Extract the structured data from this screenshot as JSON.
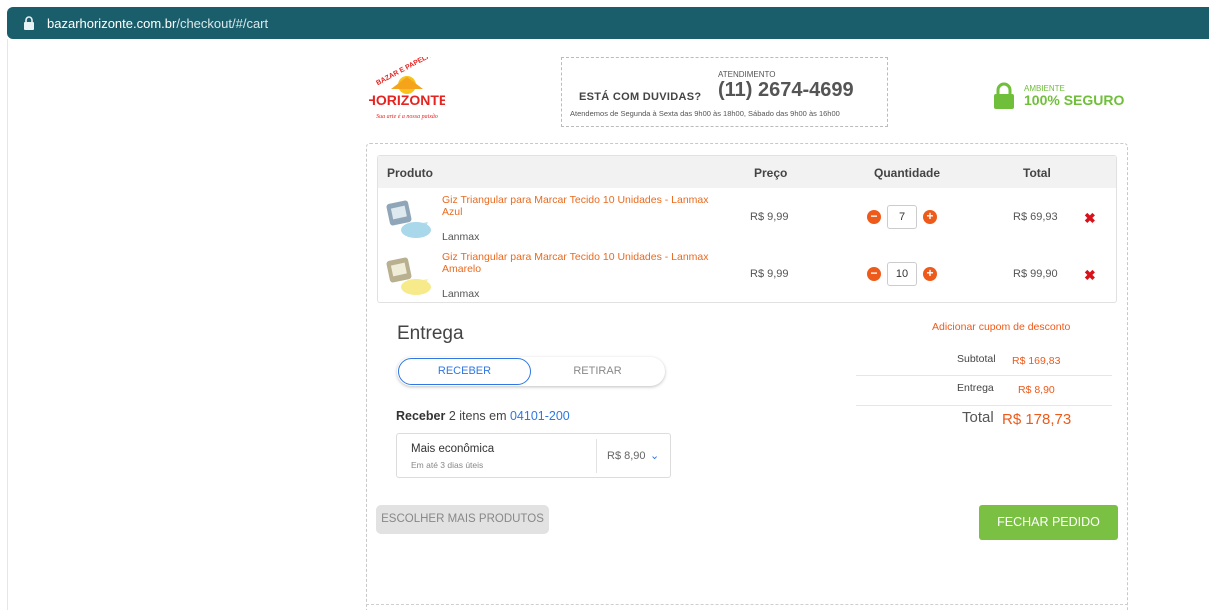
{
  "browser": {
    "url_domain": "bazarhorizonte.com.br",
    "url_path": "/checkout/#/cart"
  },
  "header": {
    "logo": {
      "top_text": "BAZAR E PAPELARIA",
      "name": "HORIZONTE",
      "tagline": "Sua arte é a nossa paixão"
    },
    "help": {
      "question": "ESTÁ COM DUVIDAS?",
      "label": "ATENDIMENTO",
      "phone": "(11) 2674-4699",
      "hours": "Atendemos de Segunda à Sexta das 9h00 às 18h00, Sábado das 9h00 às 16h00"
    },
    "secure": {
      "line1": "AMBIENTE",
      "line2": "100% SEGURO",
      "color": "#6fbf3a"
    }
  },
  "cart": {
    "columns": {
      "product": "Produto",
      "price": "Preço",
      "quantity": "Quantidade",
      "total": "Total"
    },
    "items": [
      {
        "name": "Giz Triangular para Marcar Tecido 10 Unidades - Lanmax Azul",
        "brand": "Lanmax",
        "price": "R$ 9,99",
        "quantity": "7",
        "total": "R$ 69,93",
        "thumb_color": "#a8d8ea"
      },
      {
        "name": "Giz Triangular para Marcar Tecido 10 Unidades - Lanmax Amarelo",
        "brand": "Lanmax",
        "price": "R$ 9,99",
        "quantity": "10",
        "total": "R$ 99,90",
        "thumb_color": "#f6ea8a"
      }
    ]
  },
  "delivery": {
    "title": "Entrega",
    "toggle": {
      "active": "RECEBER",
      "inactive": "RETIRAR"
    },
    "receber_bold": "Receber",
    "receber_text": " 2 itens em ",
    "cep": "04101-200",
    "method": {
      "name": "Mais econômica",
      "days": "Em até 3 dias úteis",
      "price": "R$ 8,90"
    }
  },
  "summary": {
    "coupon_link": "Adicionar cupom de desconto",
    "subtotal_label": "Subtotal",
    "subtotal_value": "R$ 169,83",
    "shipping_label": "Entrega",
    "shipping_value": "R$ 8,90",
    "total_label": "Total",
    "total_value": "R$ 178,73"
  },
  "actions": {
    "more_products": "ESCOLHER MAIS PRODUTOS",
    "checkout": "FECHAR PEDIDO"
  },
  "colors": {
    "accent_orange": "#ee5a19",
    "link_blue": "#2f77e2",
    "green": "#7ac143",
    "urlbar": "#1b5e6b"
  }
}
